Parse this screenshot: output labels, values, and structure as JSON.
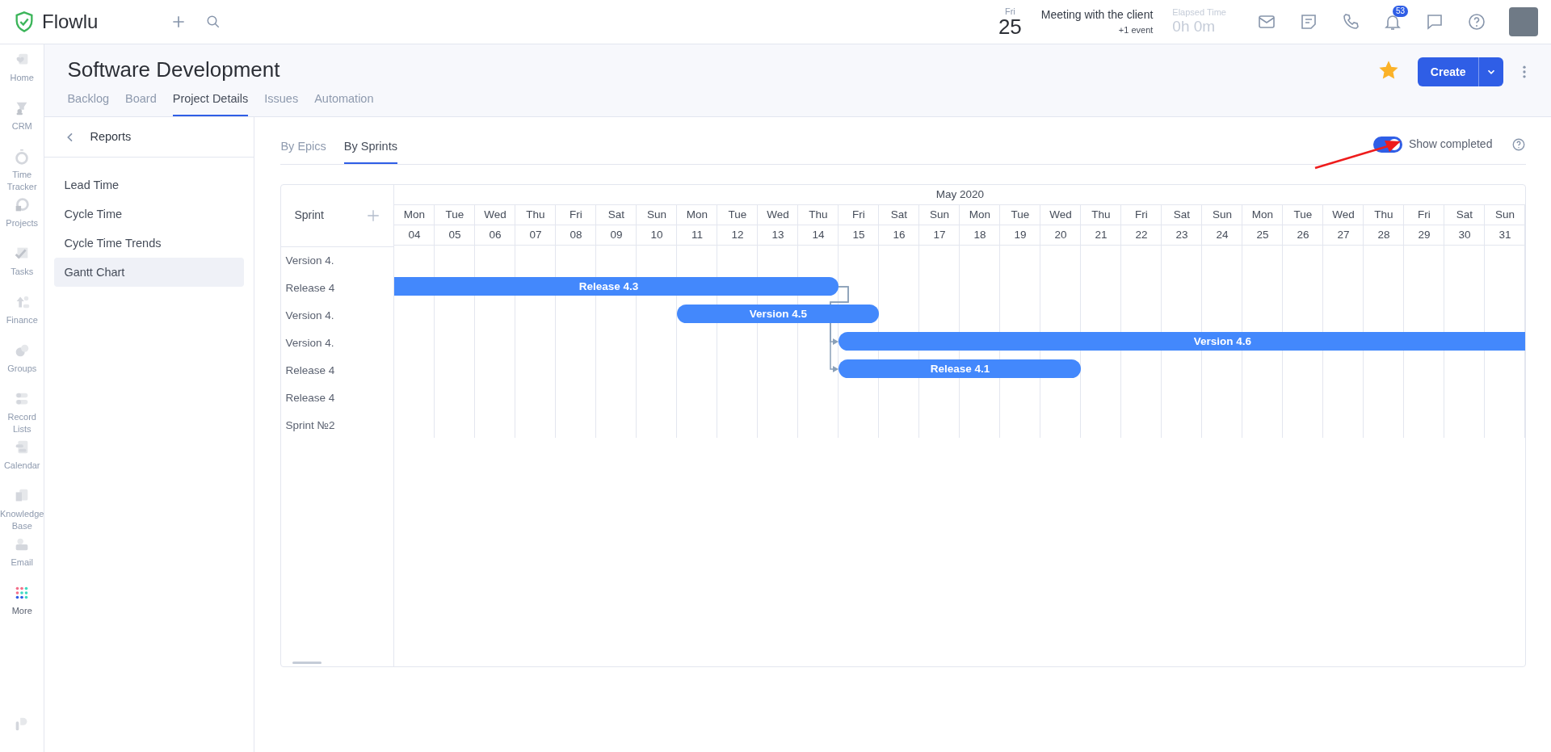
{
  "app": {
    "logo_text": "Flowlu"
  },
  "topbar": {
    "date": {
      "weekday": "Fri",
      "day": "25"
    },
    "event": {
      "title": "Meeting with the client",
      "more": "+1 event"
    },
    "timer": {
      "label": "Elapsed Time",
      "value": "0h 0m"
    },
    "icons": [
      {
        "kind": "mail"
      },
      {
        "kind": "note"
      },
      {
        "kind": "phone"
      },
      {
        "kind": "bell",
        "badge": "53"
      },
      {
        "kind": "chat"
      },
      {
        "kind": "help"
      }
    ]
  },
  "rail": [
    {
      "kind": "home",
      "label": "Home"
    },
    {
      "kind": "crm",
      "label": "CRM"
    },
    {
      "kind": "timer",
      "label": "Time Tracker"
    },
    {
      "kind": "projects",
      "label": "Projects"
    },
    {
      "kind": "tasks",
      "label": "Tasks"
    },
    {
      "kind": "finance",
      "label": "Finance"
    },
    {
      "kind": "groups",
      "label": "Groups"
    },
    {
      "kind": "lists",
      "label": "Record Lists"
    },
    {
      "kind": "calendar",
      "label": "Calendar"
    },
    {
      "kind": "kb",
      "label": "Knowledge Base"
    },
    {
      "kind": "email",
      "label": "Email"
    },
    {
      "kind": "more",
      "label": "More"
    }
  ],
  "project": {
    "title": "Software Development",
    "starred": true,
    "create_label": "Create",
    "tabs": [
      {
        "label": "Backlog",
        "selected": false
      },
      {
        "label": "Board",
        "selected": false
      },
      {
        "label": "Project Details",
        "selected": true
      },
      {
        "label": "Issues",
        "selected": false
      },
      {
        "label": "Automation",
        "selected": false
      }
    ]
  },
  "reports": {
    "title": "Reports",
    "items": [
      {
        "label": "Lead Time",
        "selected": false
      },
      {
        "label": "Cycle Time",
        "selected": false
      },
      {
        "label": "Cycle Time Trends",
        "selected": false
      },
      {
        "label": "Gantt Chart",
        "selected": true
      }
    ]
  },
  "view_tabs": [
    {
      "label": "By Epics",
      "selected": false
    },
    {
      "label": "By Sprints",
      "selected": true
    }
  ],
  "show_completed": {
    "label": "Show completed",
    "on": true
  },
  "gantt": {
    "column_label": "Sprint",
    "month": "May 2020",
    "days": [
      {
        "weekday": "Mon",
        "date": "04"
      },
      {
        "weekday": "Tue",
        "date": "05"
      },
      {
        "weekday": "Wed",
        "date": "06"
      },
      {
        "weekday": "Thu",
        "date": "07"
      },
      {
        "weekday": "Fri",
        "date": "08"
      },
      {
        "weekday": "Sat",
        "date": "09"
      },
      {
        "weekday": "Sun",
        "date": "10"
      },
      {
        "weekday": "Mon",
        "date": "11"
      },
      {
        "weekday": "Tue",
        "date": "12"
      },
      {
        "weekday": "Wed",
        "date": "13"
      },
      {
        "weekday": "Thu",
        "date": "14"
      },
      {
        "weekday": "Fri",
        "date": "15"
      },
      {
        "weekday": "Sat",
        "date": "16"
      },
      {
        "weekday": "Sun",
        "date": "17"
      },
      {
        "weekday": "Mon",
        "date": "18"
      },
      {
        "weekday": "Tue",
        "date": "19"
      },
      {
        "weekday": "Wed",
        "date": "20"
      },
      {
        "weekday": "Thu",
        "date": "21"
      },
      {
        "weekday": "Fri",
        "date": "22"
      },
      {
        "weekday": "Sat",
        "date": "23"
      },
      {
        "weekday": "Sun",
        "date": "24"
      },
      {
        "weekday": "Mon",
        "date": "25"
      },
      {
        "weekday": "Tue",
        "date": "26"
      },
      {
        "weekday": "Wed",
        "date": "27"
      },
      {
        "weekday": "Thu",
        "date": "28"
      },
      {
        "weekday": "Fri",
        "date": "29"
      },
      {
        "weekday": "Sat",
        "date": "30"
      },
      {
        "weekday": "Sun",
        "date": "31"
      }
    ],
    "rows": [
      {
        "name": "Version 4."
      },
      {
        "name": "Release 4",
        "bar": {
          "label": "Release 4.3",
          "continues_left": true,
          "link_out": true,
          "covered": [
            true,
            true,
            true,
            true,
            true,
            true,
            true,
            true,
            true,
            true,
            true,
            false,
            false,
            false,
            false,
            false,
            false,
            false,
            false,
            false,
            false,
            false,
            false,
            false,
            false,
            false,
            false,
            false
          ]
        }
      },
      {
        "name": "Version 4.",
        "bar": {
          "label": "Version 4.5",
          "covered": [
            false,
            false,
            false,
            false,
            false,
            false,
            false,
            true,
            true,
            true,
            true,
            true,
            false,
            false,
            false,
            false,
            false,
            false,
            false,
            false,
            false,
            false,
            false,
            false,
            false,
            false,
            false,
            false
          ]
        }
      },
      {
        "name": "Version 4.",
        "bar": {
          "label": "Version 4.6",
          "continues_right": true,
          "link_in": true,
          "covered": [
            false,
            false,
            false,
            false,
            false,
            false,
            false,
            false,
            false,
            false,
            false,
            true,
            true,
            true,
            true,
            true,
            true,
            true,
            true,
            true,
            true,
            true,
            true,
            true,
            true,
            true,
            true,
            true
          ]
        }
      },
      {
        "name": "Release 4",
        "bar": {
          "label": "Release 4.1",
          "link_in": true,
          "covered": [
            false,
            false,
            false,
            false,
            false,
            false,
            false,
            false,
            false,
            false,
            false,
            true,
            true,
            true,
            true,
            true,
            true,
            false,
            false,
            false,
            false,
            false,
            false,
            false,
            false,
            false,
            false,
            false
          ]
        }
      },
      {
        "name": "Release 4"
      },
      {
        "name": "Sprint №2"
      }
    ]
  }
}
